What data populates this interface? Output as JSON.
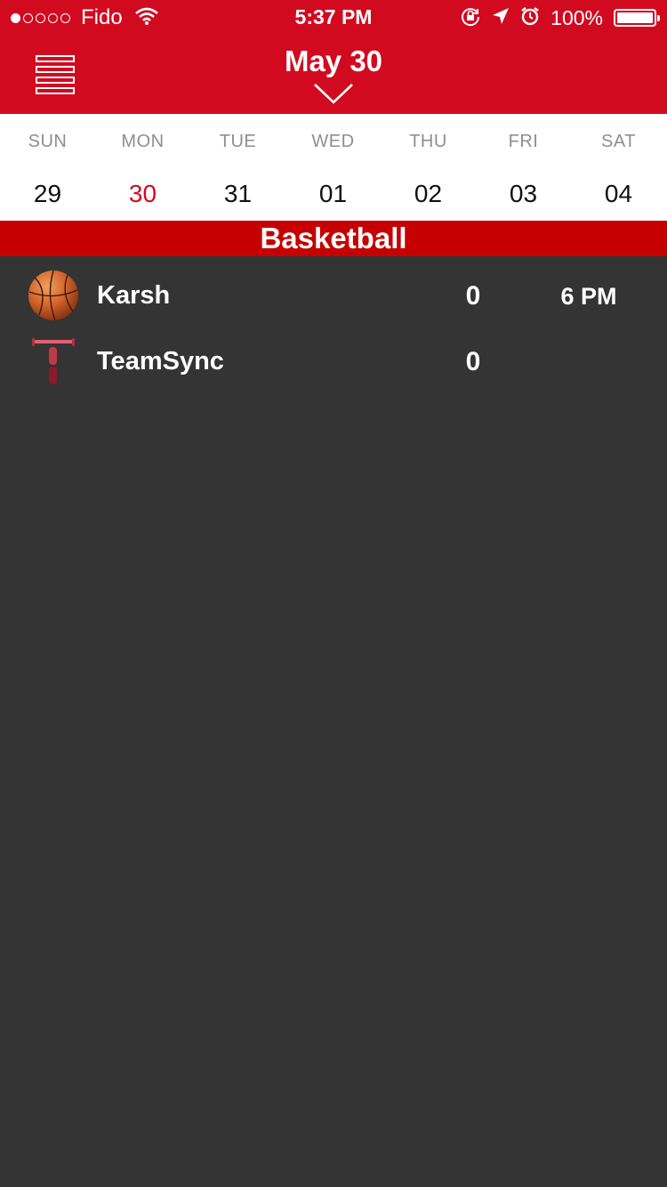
{
  "status_bar": {
    "carrier": "Fido",
    "signal_bars_filled": 1,
    "signal_bars_total": 5,
    "time": "5:37 PM",
    "battery_percent": "100%",
    "icons": [
      "wifi-icon",
      "rotation-lock-icon",
      "location-arrow-icon",
      "alarm-icon",
      "battery-icon"
    ]
  },
  "header": {
    "title": "May 30",
    "menu_icon": "menu-icon",
    "dropdown_icon": "chevron-down-icon"
  },
  "week": {
    "days": [
      {
        "name": "SUN",
        "date": "29"
      },
      {
        "name": "MON",
        "date": "30"
      },
      {
        "name": "TUE",
        "date": "31"
      },
      {
        "name": "WED",
        "date": "01"
      },
      {
        "name": "THU",
        "date": "02"
      },
      {
        "name": "FRI",
        "date": "03"
      },
      {
        "name": "SAT",
        "date": "04"
      }
    ],
    "selected_index": 1
  },
  "section": {
    "title": "Basketball"
  },
  "game": {
    "teams": [
      {
        "name": "Karsh",
        "score": "0",
        "logo": "basketball-icon"
      },
      {
        "name": "TeamSync",
        "score": "0",
        "logo": "teamsync-logo-icon"
      }
    ],
    "time": "6 PM"
  },
  "colors": {
    "brand_red": "#d10a20",
    "section_red": "#c60000",
    "background": "#343434",
    "text_light": "#ffffff",
    "day_name_gray": "#8e8e93"
  }
}
